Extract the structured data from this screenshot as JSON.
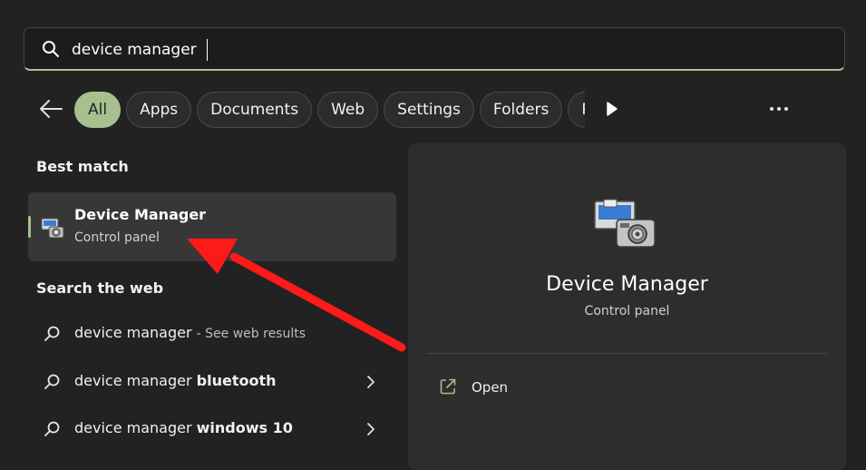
{
  "search": {
    "value": "device manager",
    "icon": "search-icon"
  },
  "filters": {
    "back_icon": "arrow-left-icon",
    "chips": [
      "All",
      "Apps",
      "Documents",
      "Web",
      "Settings",
      "Folders",
      "Photos"
    ],
    "active": "All",
    "accent": "#a7c08e",
    "play_icon": "play-icon",
    "more_icon": "more-icon"
  },
  "best_match": {
    "heading": "Best match",
    "title": "Device Manager",
    "subtitle": "Control panel",
    "icon": "device-manager-icon"
  },
  "web": {
    "heading": "Search the web",
    "items": [
      {
        "query": "device manager",
        "bold": "",
        "hint": "- See web results"
      },
      {
        "query": "device manager ",
        "bold": "bluetooth",
        "hint": ""
      },
      {
        "query": "device manager ",
        "bold": "windows 10",
        "hint": ""
      }
    ]
  },
  "preview": {
    "title": "Device Manager",
    "subtitle": "Control panel",
    "action_open": "Open",
    "icon": "device-manager-icon"
  },
  "annotation": {
    "color": "#ff0000",
    "type": "red-arrow"
  }
}
